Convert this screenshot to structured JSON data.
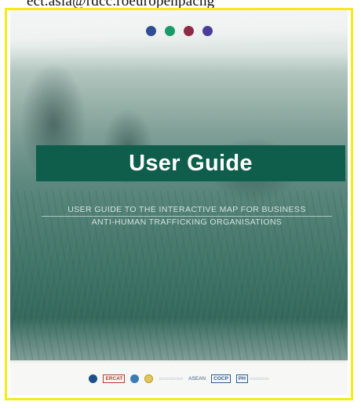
{
  "top_cutoff_text": "ect.asia@rdcc.roeuropenpacng",
  "cover": {
    "title": "User Guide",
    "subtitle_line1": "USER GUIDE TO THE INTERACTIVE MAP FOR BUSINESS",
    "subtitle_line2": "ANTI-HUMAN TRAFFICKING ORGANISATIONS",
    "dot_colors": [
      "#2e4d93",
      "#1b9a6d",
      "#8f2a4a",
      "#4b3e9a"
    ],
    "title_bar_color": "#0f5e4c",
    "frame_color": "#f6ea1a"
  },
  "footer_logos": [
    {
      "icon": "round-emblem-logo",
      "text": ""
    },
    {
      "icon": "ercat-logo",
      "text": "ERCAT"
    },
    {
      "icon": "globe-logo",
      "text": ""
    },
    {
      "icon": "seal-logo",
      "text": ""
    },
    {
      "icon": "faint-wordmark-logo",
      "text": ""
    },
    {
      "icon": "asean-logo",
      "text": "ASEAN"
    },
    {
      "icon": "cocp-logo",
      "text": "COCP"
    },
    {
      "icon": "partners-logo",
      "text": "PH"
    }
  ]
}
